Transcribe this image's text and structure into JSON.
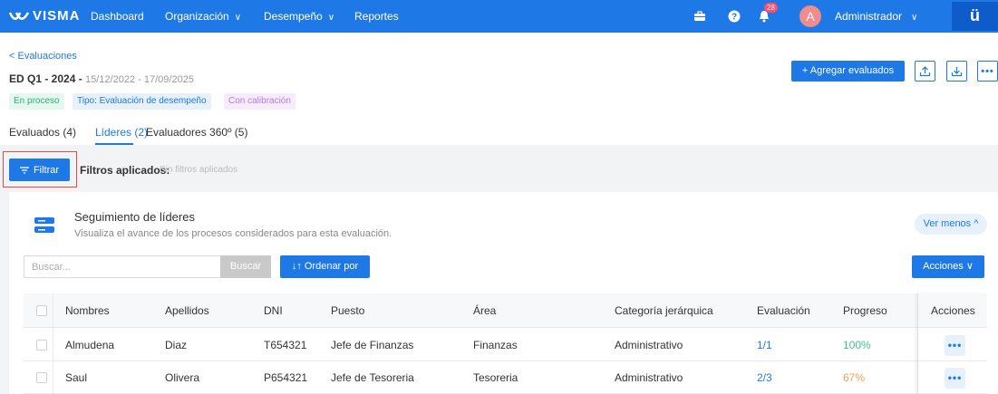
{
  "topbar": {
    "logo": "VISMA",
    "nav": [
      {
        "label": "Dashboard"
      },
      {
        "label": "Organización",
        "caret": "∨"
      },
      {
        "label": "Desempeño",
        "caret": "∨"
      },
      {
        "label": "Reportes"
      }
    ],
    "notifications_count": "28",
    "avatar_letter": "A",
    "user_name": "Administrador",
    "user_caret": "∨",
    "brand_glyph": "ü",
    "icons": [
      "briefcase-icon",
      "help-icon",
      "bell-icon"
    ]
  },
  "header": {
    "back_link": "< Evaluaciones",
    "title_bold": "ED Q1 - 2024 - ",
    "dates": "15/12/2022 - 17/09/2025",
    "tags": [
      "En proceso",
      "Tipo: Evaluación de desempeño",
      "Con calibración"
    ],
    "add_button": "+ Agregar evaluados"
  },
  "tabs": [
    {
      "label": "Evaluados (4)",
      "active": false
    },
    {
      "label": "Líderes (2)",
      "active": true
    },
    {
      "label": "Evaluadores 360º (5)",
      "active": false
    }
  ],
  "filter": {
    "button": "Filtrar",
    "label": "Filtros aplicados:",
    "value": "Sin filtros aplicados"
  },
  "card": {
    "title": "Seguimiento de líderes",
    "subtitle": "Visualiza el avance de los procesos considerados para esta evaluación.",
    "toggle": "Ver menos ^",
    "search_placeholder": "Buscar...",
    "search_button": "Buscar",
    "sort_button": "↓↑ Ordenar por",
    "actions_button": "Acciones ∨"
  },
  "table": {
    "columns": [
      "Nombres",
      "Apellidos",
      "DNI",
      "Puesto",
      "Área",
      "Categoría jerárquica",
      "Evaluación",
      "Progreso",
      "Acciones"
    ],
    "rows": [
      {
        "nombres": "Almudena",
        "apellidos": "Diaz",
        "dni": "T654321",
        "puesto": "Jefe de Finanzas",
        "area": "Finanzas",
        "categoria": "Administrativo",
        "evaluacion": "1/1",
        "progreso": "100%",
        "progreso_color": "#3cc08e"
      },
      {
        "nombres": "Saul",
        "apellidos": "Olivera",
        "dni": "P654321",
        "puesto": "Jefe de Tesoreria",
        "area": "Tesoreria",
        "categoria": "Administrativo",
        "evaluacion": "2/3",
        "progreso": "67%",
        "progreso_color": "#f5a15a"
      }
    ]
  },
  "colors": {
    "primary": "#1e78e6",
    "highlight": "#e54848"
  }
}
